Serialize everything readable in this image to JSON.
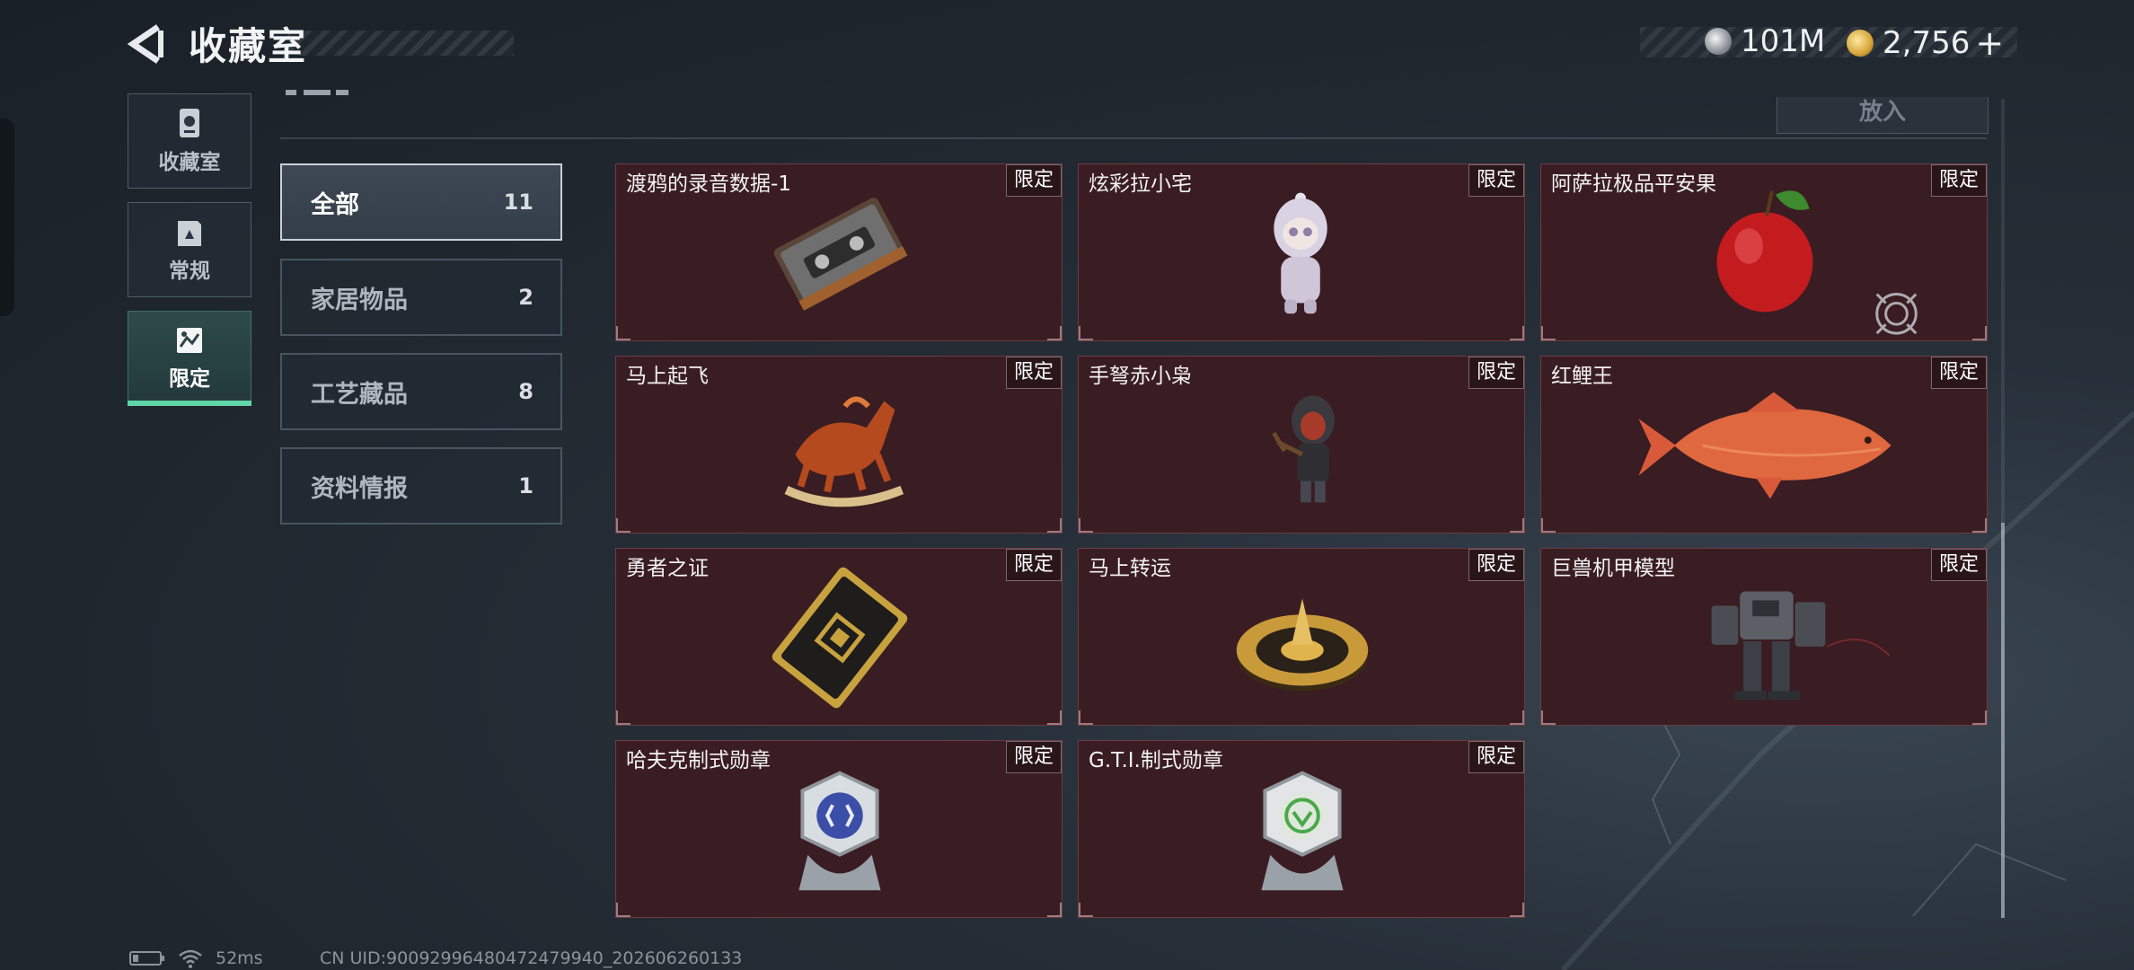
{
  "header": {
    "title": "收藏室",
    "currency_1": "101M",
    "currency_2": "2,756",
    "add_symbol": "+"
  },
  "rail": {
    "tabs": [
      {
        "label": "收藏室",
        "icon": "collection-room-icon"
      },
      {
        "label": "常规",
        "icon": "regular-book-icon"
      },
      {
        "label": "限定",
        "icon": "limited-picture-icon"
      }
    ],
    "active_index": 2
  },
  "toolbar": {
    "put_label": "放入"
  },
  "categories": [
    {
      "name": "全部",
      "count": "11"
    },
    {
      "name": "家居物品",
      "count": "2"
    },
    {
      "name": "工艺藏品",
      "count": "8"
    },
    {
      "name": "资料情报",
      "count": "1"
    }
  ],
  "items": [
    {
      "name": "渡鸦的录音数据-1",
      "tag": "限定",
      "icon": "cassette-tape-icon"
    },
    {
      "name": "炫彩拉小宅",
      "tag": "限定",
      "icon": "hooded-doll-figure-icon"
    },
    {
      "name": "阿萨拉极品平安果",
      "tag": "限定",
      "icon": "red-apple-icon"
    },
    {
      "name": "马上起飞",
      "tag": "限定",
      "icon": "rocking-horse-icon"
    },
    {
      "name": "手弩赤小枭",
      "tag": "限定",
      "icon": "crossbow-figure-icon"
    },
    {
      "name": "红鲤王",
      "tag": "限定",
      "icon": "red-carp-icon"
    },
    {
      "name": "勇者之证",
      "tag": "限定",
      "icon": "gold-card-icon"
    },
    {
      "name": "马上转运",
      "tag": "限定",
      "icon": "golden-spinner-icon"
    },
    {
      "name": "巨兽机甲模型",
      "tag": "限定",
      "icon": "mech-model-icon"
    },
    {
      "name": "哈夫克制式勋章",
      "tag": "限定",
      "icon": "blue-medal-icon"
    },
    {
      "name": "G.T.I.制式勋章",
      "tag": "限定",
      "icon": "green-medal-icon"
    }
  ],
  "status": {
    "ping": "52ms",
    "uid": "CN UID:9009299648047247994​0_202606260133"
  },
  "colors": {
    "accent": "#5fd6a6",
    "card_bg": "#3a1d22"
  }
}
